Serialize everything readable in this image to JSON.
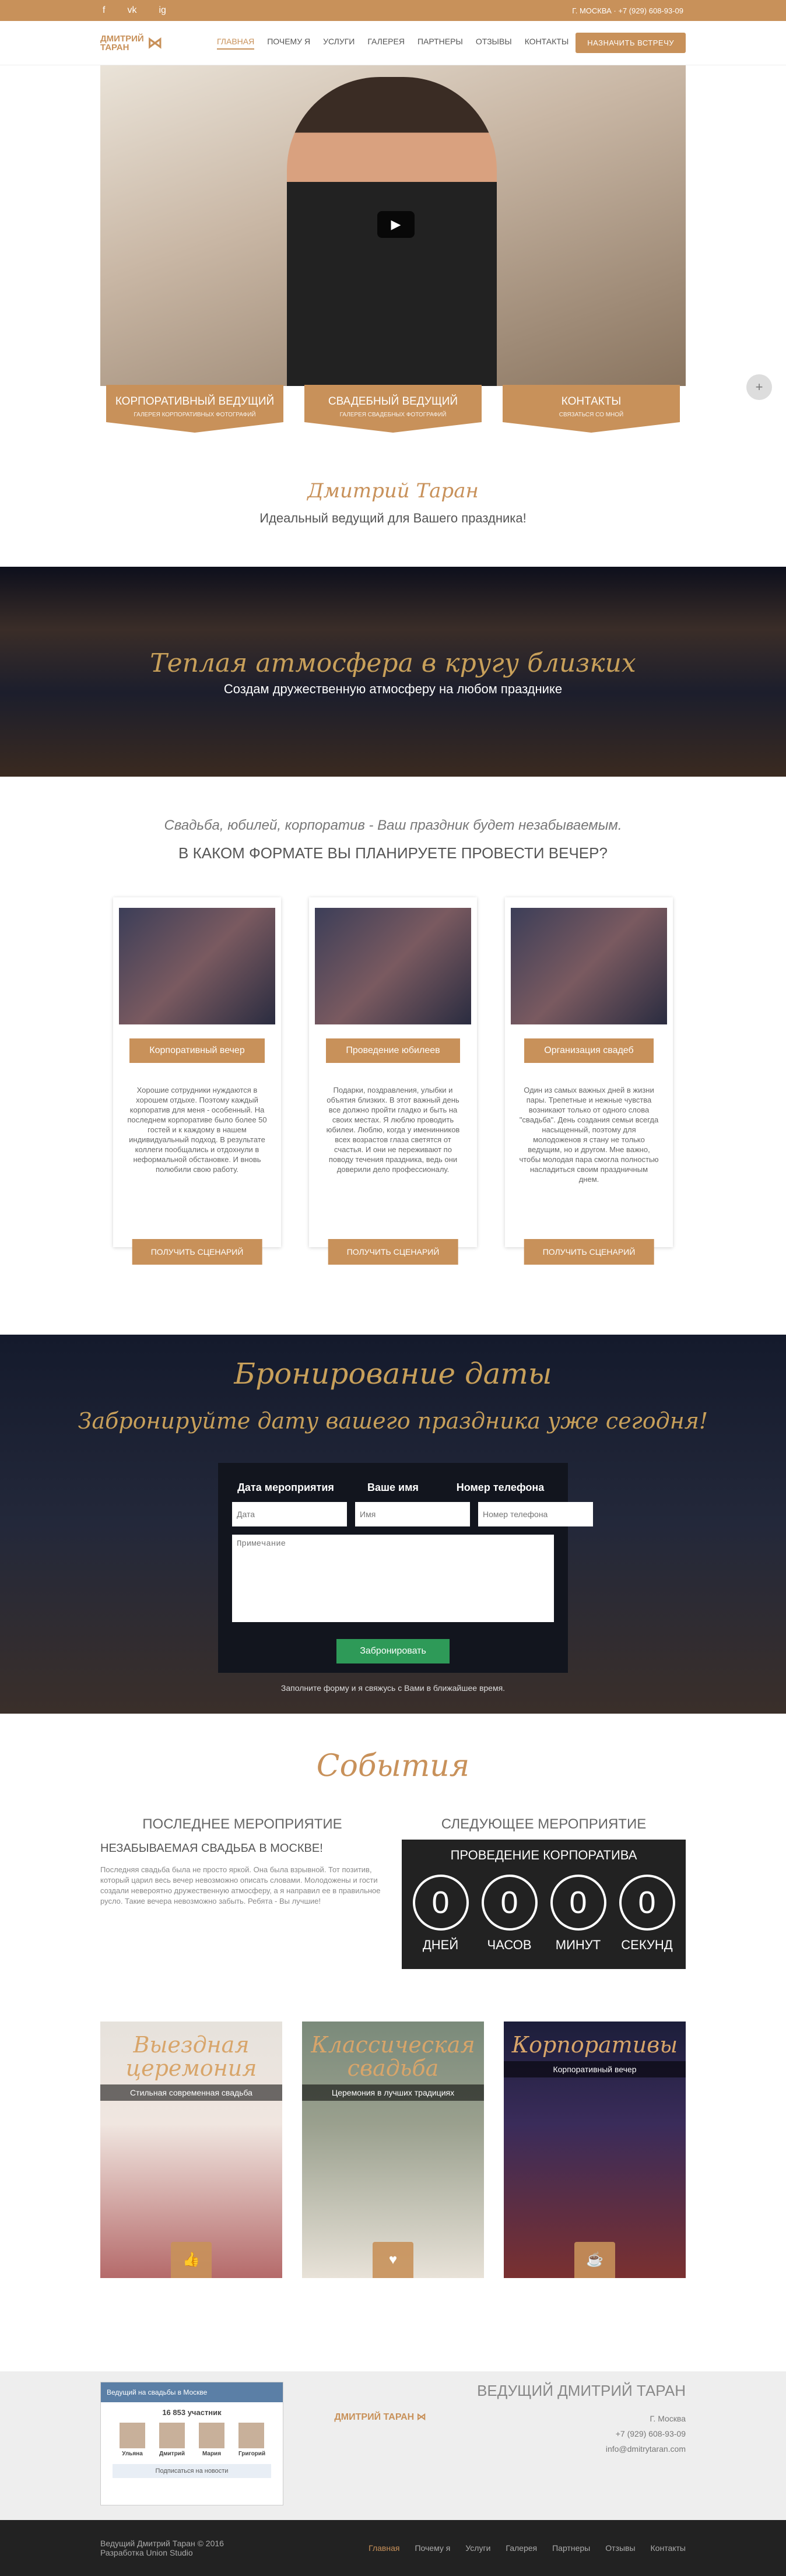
{
  "topbar": {
    "socials": [
      "f",
      "vk",
      "ig"
    ],
    "contact": "Г. МОСКВА · +7 (929) 608-93-09"
  },
  "logo": {
    "line1": "ДМИТРИЙ",
    "line2": "ТАРАН"
  },
  "menu": [
    "ГЛАВНАЯ",
    "ПОЧЕМУ Я",
    "УСЛУГИ",
    "ГАЛЕРЕЯ",
    "ПАРТНЕРЫ",
    "ОТЗЫВЫ",
    "КОНТАКТЫ"
  ],
  "nav_button": "НАЗНАЧИТЬ ВСТРЕЧУ",
  "tabs": [
    {
      "title": "КОРПОРАТИВНЫЙ ВЕДУЩИЙ",
      "sub": "ГАЛЕРЕЯ КОРПОРАТИВНЫХ ФОТОГРАФИЙ"
    },
    {
      "title": "СВАДЕБНЫЙ ВЕДУЩИЙ",
      "sub": "ГАЛЕРЕЯ СВАДЕБНЫХ ФОТОГРАФИЙ"
    },
    {
      "title": "КОНТАКТЫ",
      "sub": "СВЯЗАТЬСЯ СО МНОЙ"
    }
  ],
  "intro": {
    "name": "Дмитрий Таран",
    "sub": "Идеальный ведущий для Вашего праздника!"
  },
  "warm": {
    "title": "Теплая атмосфера в кругу близких",
    "sub": "Создам дружественную атмосферу на любом празднике"
  },
  "formats": {
    "italic": "Свадьба, юбилей, корпоратив - Ваш праздник будет незабываемым.",
    "question": "В КАКОМ ФОРМАТЕ ВЫ ПЛАНИРУЕТЕ ПРОВЕСТИ ВЕЧЕР?"
  },
  "cards": [
    {
      "btn": "Корпоративный вечер",
      "text": "Хорошие сотрудники нуждаются в хорошем отдыхе. Поэтому каждый корпоратив для меня - особенный. На последнем корпоративе было более 50 гостей и к каждому в нашем индивидуальный подход. В результате коллеги пообщались и отдохнули в неформальной обстановке. И вновь полюбили свою работу.",
      "order": "ПОЛУЧИТЬ СЦЕНАРИЙ"
    },
    {
      "btn": "Проведение юбилеев",
      "text": "Подарки, поздравления, улыбки и объятия близких. В этот важный день все должно пройти гладко и быть на своих местах. Я люблю проводить юбилеи. Люблю, когда у именинников всех возрастов глаза светятся от счастья. И они не переживают по поводу течения праздника, ведь они доверили дело профессионалу.",
      "order": "ПОЛУЧИТЬ СЦЕНАРИЙ"
    },
    {
      "btn": "Организация свадеб",
      "text": "Один из самых важных дней в жизни пары. Трепетные и нежные чувства возникают только от одного слова \"свадьба\". День создания семьи всегда насыщенный, поэтому для молодоженов я стану не только ведущим, но и другом. Мне важно, чтобы молодая пара смогла полностью насладиться своим праздничным днем.",
      "order": "ПОЛУЧИТЬ СЦЕНАРИЙ"
    }
  ],
  "booking": {
    "title": "Бронирование даты",
    "sub": "Забронируйте дату вашего праздника уже сегодня!",
    "labels": [
      "Дата мероприятия",
      "Ваше имя",
      "Номер телефона"
    ],
    "placeholders": [
      "Дата",
      "Имя",
      "Номер телефона"
    ],
    "comment": "Примечание",
    "send": "Забронировать",
    "note": "Заполните форму и я свяжусь с Вами в ближайшее время."
  },
  "events": {
    "title": "События",
    "last_h": "ПОСЛЕДНЕЕ МЕРОПРИЯТИЕ",
    "last_t": "НЕЗАБЫВАЕМАЯ СВАДЬБА В МОСКВЕ!",
    "last_p": "Последняя свадьба была не просто яркой. Она была взрывной. Тот позитив, который царил весь вечер невозможно описать словами. Молодожены и гости создали невероятно дружественную атмосферу, а я направил ее в правильное русло. Такие вечера невозможно забыть. Ребята - Вы лучшие!",
    "next_h": "СЛЕДУЮЩЕЕ МЕРОПРИЯТИЕ",
    "next_t": "ПРОВЕДЕНИЕ КОРПОРАТИВА",
    "counts": [
      {
        "v": "0",
        "l": "ДНЕЙ"
      },
      {
        "v": "0",
        "l": "ЧАСОВ"
      },
      {
        "v": "0",
        "l": "МИНУТ"
      },
      {
        "v": "0",
        "l": "СЕКУНД"
      }
    ]
  },
  "pics": [
    {
      "h": "Выездная церемония",
      "s": "Стильная современная свадьба",
      "icon": "👍"
    },
    {
      "h": "Классическая свадьба",
      "s": "Церемония в лучших традициях",
      "icon": "♥"
    },
    {
      "h": "Корпоративы",
      "s": "Корпоративный вечер",
      "icon": "☕"
    }
  ],
  "footer": {
    "vk_title": "Ведущий на свадьбы в Москве",
    "members": "16 853 участник",
    "people": [
      "Ульяна",
      "Дмитрий",
      "Мария",
      "Григорий"
    ],
    "subscribe": "Подписаться на новости",
    "name": "ВЕДУЩИЙ ДМИТРИЙ ТАРАН",
    "city": "Г. Москва",
    "phone": "+7 (929) 608-93-09",
    "email": "info@dmitrytaran.com"
  },
  "bottom": {
    "copy": "Ведущий Дмитрий Таран © 2016",
    "dev": "Разработка Union Studio",
    "menu": [
      "Главная",
      "Почему я",
      "Услуги",
      "Галерея",
      "Партнеры",
      "Отзывы",
      "Контакты"
    ]
  }
}
